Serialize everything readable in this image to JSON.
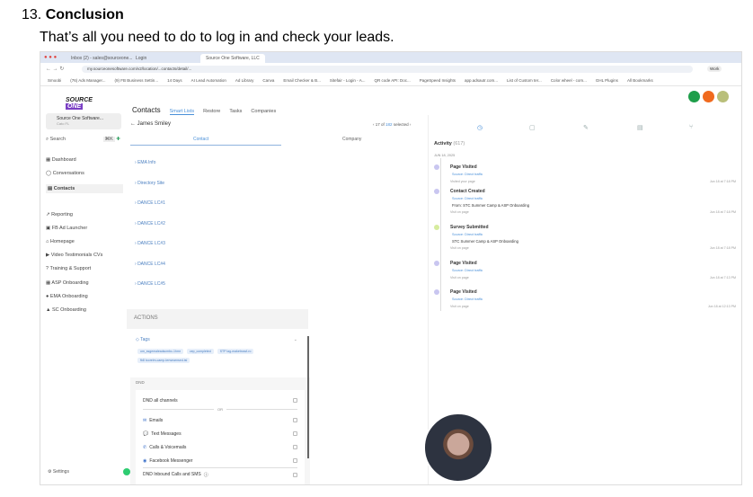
{
  "heading": {
    "number": "13.",
    "title": "Conclusion",
    "subtitle": "That’s all you need to do to log in and check your leads."
  },
  "browser": {
    "tabs": [
      "Inbox (2) - sales@sourceone...",
      "Login",
      "Source One Software, LLC"
    ],
    "url": "my.sourceonesoftware.com/v2/location/...contacts/detail/...",
    "bookmarks": [
      "Smoobi",
      "(76) Ads Manager...",
      "(9) FB Business Settin...",
      "14 Days",
      "AI Lead Automation",
      "Ad Library",
      "Canva",
      "Email Checker & B...",
      "Sitefair - Login - A...",
      "QR code API: Doc...",
      "PageSpeed Insights",
      "app.adsautr.com...",
      "List of Custom ter...",
      "Color wheel - com...",
      "GHL Plugins",
      "All Bookmarks"
    ],
    "profile": "Work"
  },
  "app": {
    "logo": "SOURCE ONE",
    "account": {
      "name": "Source One Software...",
      "location": "Cato FL"
    },
    "search": {
      "label": "Search",
      "shortcut": "⌘K"
    },
    "nav": [
      "Dashboard",
      "Conversations",
      "Contacts",
      "Reporting",
      "FB Ad Launcher",
      "Homepage",
      "Video Testimonials CVs",
      "Training & Support",
      "ASP Onboarding",
      "EMA Onboarding",
      "SC Onboarding"
    ],
    "settings": "Settings",
    "tabs": {
      "main": "Contacts",
      "items": [
        "Smart Lists",
        "Restore",
        "Tasks",
        "Companies"
      ]
    },
    "contact_name": "James Smiley",
    "counter": {
      "position": "17 of",
      "total": "182",
      "suffix": "selected"
    },
    "columns": [
      "Contact",
      "Company"
    ],
    "sections": [
      "EMA Info",
      "Directory Site",
      "DANCE LC#1",
      "DANCE LC#2",
      "DANCE LC#3",
      "DANCE LC#4",
      "DANCE LC#5"
    ],
    "actions_label": "ACTIONS",
    "tags_label": "Tags",
    "tags": [
      "om_ssgemaleadscmbc-1hmr",
      "cep_completed",
      "STP lag-maketrcssf-ro",
      "fb8 tooreim-camp-terwearnsed-tsl"
    ],
    "dnd": {
      "label": "DND",
      "all": "DND all channels",
      "or": "OR",
      "channels": [
        "Emails",
        "Text Messages",
        "Calls & Voicemails",
        "Facebook Messenger"
      ],
      "inbound": "DND Inbound Calls and SMS"
    },
    "activity": {
      "title": "Activity",
      "count": "(617)",
      "date": "JUN 18, 2025",
      "events": [
        {
          "title": "Page Visited",
          "source": "Source: Direct traffic",
          "detail": "",
          "meta": "Visited your page",
          "time": "Jun 18 at 7:18 PM"
        },
        {
          "title": "Contact Created",
          "source": "Source: Direct traffic",
          "detail": "From: STC Summer Camp & ASP Onboarding",
          "meta": "Visit on page",
          "time": "Jun 18 at 7:18 PM"
        },
        {
          "title": "Survey Submitted",
          "source": "Source: Direct traffic",
          "detail": "STC Summer Camp & ASP Onboarding",
          "meta": "Visit on page",
          "time": "Jun 18 at 7:18 PM"
        },
        {
          "title": "Page Visited",
          "source": "Source: Direct traffic",
          "detail": "",
          "meta": "Visit on page",
          "time": "Jun 18 at 7:13 PM"
        },
        {
          "title": "Page Visited",
          "source": "Source: Direct traffic",
          "detail": "",
          "meta": "Visit on page",
          "time": "Jun 18 at 12:13 PM"
        }
      ]
    },
    "colors": {
      "accent": "#4a90d9",
      "call": "#1e9e4a",
      "notify": "#f06a1e",
      "avatar": "#b9bf7a"
    }
  }
}
